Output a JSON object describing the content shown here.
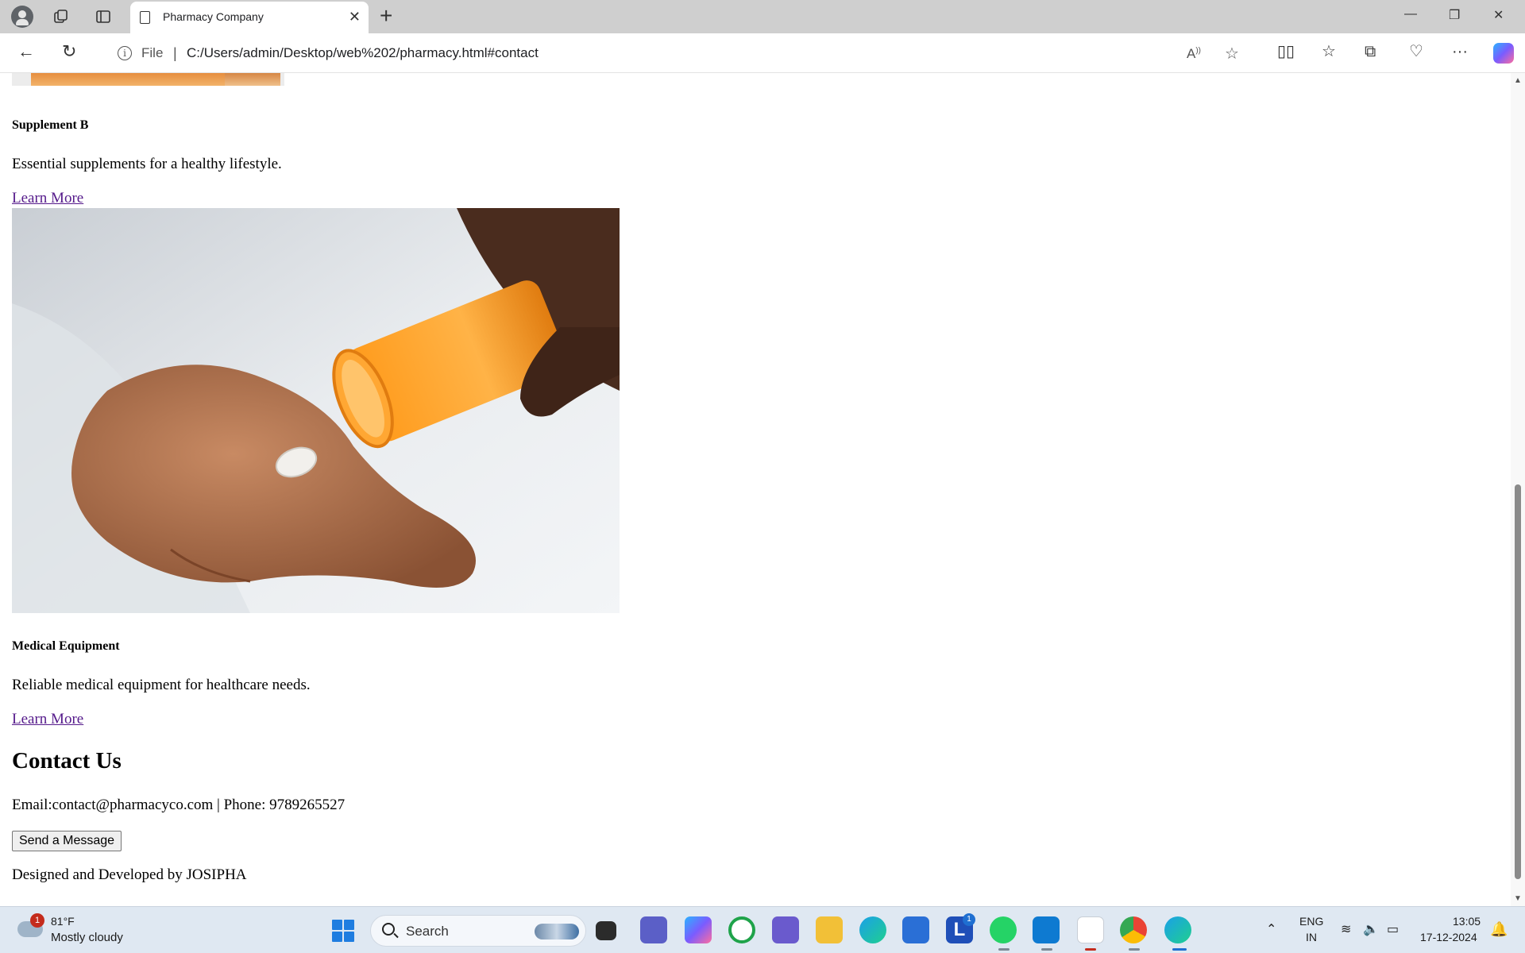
{
  "browser": {
    "tab_title": "Pharmacy Company",
    "address": {
      "scheme_label": "File",
      "separator": "|",
      "url": "C:/Users/admin/Desktop/web%202/pharmacy.html#contact"
    }
  },
  "page": {
    "products": [
      {
        "name": "Supplement B",
        "description": "Essential supplements for a healthy lifestyle.",
        "link": "Learn More"
      },
      {
        "name": "Medical Equipment",
        "description": "Reliable medical equipment for healthcare needs.",
        "link": "Learn More"
      }
    ],
    "contact": {
      "heading": "Contact Us",
      "details": "Email:contact@pharmacyco.com | Phone: 9789265527",
      "button": "Send a Message"
    },
    "footer": "Designed and Developed by JOSIPHA",
    "scroll_position": 0.93
  },
  "taskbar": {
    "weather": {
      "badge": "1",
      "temp": "81°F",
      "desc": "Mostly cloudy"
    },
    "search_label": "Search",
    "app_badge_l": "1",
    "lang_line1": "ENG",
    "lang_line2": "IN",
    "time": "13:05",
    "date": "17-12-2024"
  },
  "colors": {
    "link": "#551a8b",
    "taskbar": "#dfe8f2",
    "tabbar": "#cfcfcf",
    "windows_blue": "#1f7de0"
  }
}
